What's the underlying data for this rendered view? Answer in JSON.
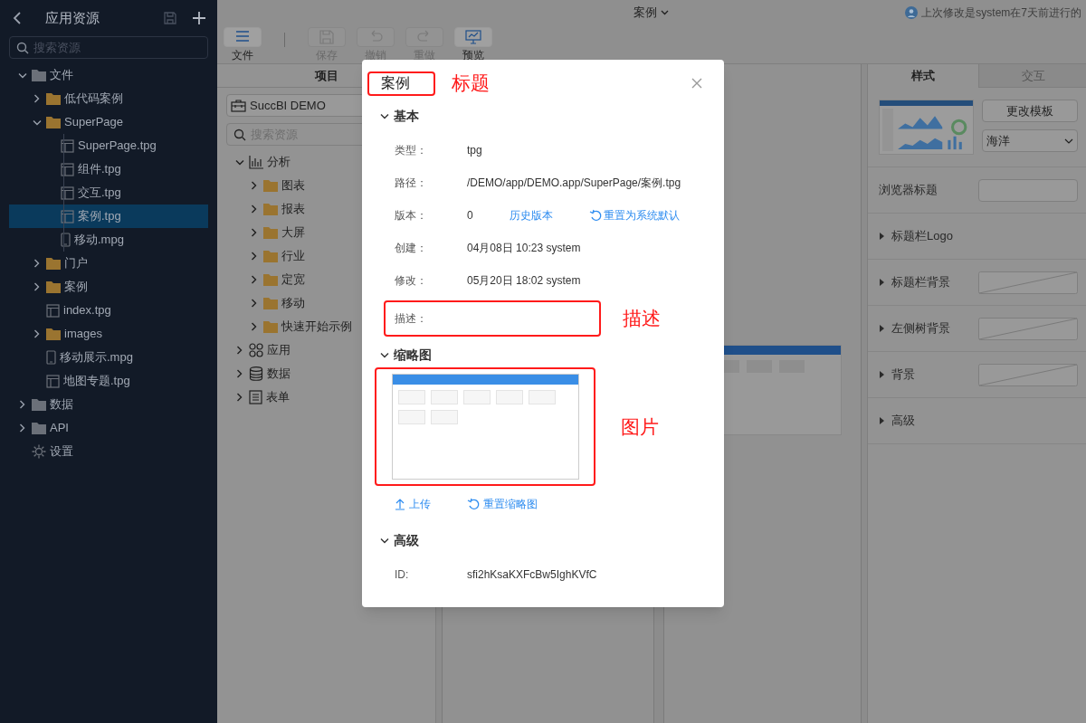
{
  "sidebar": {
    "title": "应用资源",
    "search": {
      "placeholder": "搜索资源"
    },
    "tree": [
      {
        "label": "文件",
        "kind": "folder",
        "expanded": true,
        "selected": false,
        "children": [
          {
            "label": "低代码案例",
            "kind": "folder",
            "expanded": false,
            "selected": false
          },
          {
            "label": "SuperPage",
            "kind": "folder",
            "expanded": true,
            "selected": false,
            "children": [
              {
                "label": "SuperPage.tpg",
                "kind": "page",
                "selected": false
              },
              {
                "label": "组件.tpg",
                "kind": "page",
                "selected": false
              },
              {
                "label": "交互.tpg",
                "kind": "page",
                "selected": false
              },
              {
                "label": "案例.tpg",
                "kind": "page",
                "selected": true
              },
              {
                "label": "移动.mpg",
                "kind": "mobile",
                "selected": false
              }
            ]
          },
          {
            "label": "门户",
            "kind": "folder",
            "expanded": false,
            "selected": false
          },
          {
            "label": "案例",
            "kind": "folder",
            "expanded": false,
            "selected": false
          },
          {
            "label": "index.tpg",
            "kind": "page",
            "selected": false
          },
          {
            "label": "images",
            "kind": "folder",
            "expanded": false,
            "selected": false
          },
          {
            "label": "移动展示.mpg",
            "kind": "mobile",
            "selected": false
          },
          {
            "label": "地图专题.tpg",
            "kind": "page",
            "selected": false
          }
        ]
      },
      {
        "label": "数据",
        "kind": "folder",
        "expanded": false,
        "selected": false
      },
      {
        "label": "API",
        "kind": "folder",
        "expanded": false,
        "selected": false
      },
      {
        "label": "设置",
        "kind": "settings",
        "selected": false
      }
    ]
  },
  "topbar": {
    "title": "案例",
    "last_modified": "上次修改是system在7天前进行的"
  },
  "toolbar": [
    {
      "label": "文件",
      "kind": "menu",
      "disabled": false
    },
    {
      "label": "保存",
      "kind": "save",
      "disabled": true
    },
    {
      "label": "撤销",
      "kind": "undo",
      "disabled": true
    },
    {
      "label": "重做",
      "kind": "redo",
      "disabled": true
    },
    {
      "label": "预览",
      "kind": "preview",
      "disabled": false
    }
  ],
  "project_panel": {
    "header": "项目",
    "project": "SuccBI DEMO",
    "search": {
      "placeholder": "搜索资源"
    },
    "tree": [
      {
        "label": "分析",
        "kind": "chart",
        "expanded": true,
        "selected": false,
        "children": [
          {
            "label": "图表",
            "kind": "folder",
            "expanded": false,
            "selected": false
          },
          {
            "label": "报表",
            "kind": "folder",
            "expanded": false,
            "selected": false
          },
          {
            "label": "大屏",
            "kind": "folder",
            "expanded": false,
            "selected": false
          },
          {
            "label": "行业",
            "kind": "folder",
            "expanded": false,
            "selected": false
          },
          {
            "label": "定宽",
            "kind": "folder",
            "expanded": false,
            "selected": false
          },
          {
            "label": "移动",
            "kind": "folder",
            "expanded": false,
            "selected": false
          },
          {
            "label": "快速开始示例",
            "kind": "folder",
            "expanded": false,
            "selected": false
          }
        ]
      },
      {
        "label": "应用",
        "kind": "apps",
        "expanded": false,
        "selected": false
      },
      {
        "label": "数据",
        "kind": "database",
        "expanded": false,
        "selected": false
      },
      {
        "label": "表单",
        "kind": "form",
        "expanded": false,
        "selected": false
      }
    ]
  },
  "style_panel": {
    "tabs": [
      {
        "label": "样式",
        "selected": true
      },
      {
        "label": "交互",
        "selected": false
      }
    ],
    "change_template": "更改模板",
    "theme": "海洋",
    "rows": [
      {
        "label": "浏览器标题",
        "kind": "input"
      },
      {
        "label": "标题栏Logo",
        "kind": "section",
        "expanded": false,
        "swatch": false
      },
      {
        "label": "标题栏背景",
        "kind": "section",
        "expanded": false,
        "swatch": true
      },
      {
        "label": "左侧树背景",
        "kind": "section",
        "expanded": false,
        "swatch": true
      },
      {
        "label": "背景",
        "kind": "section",
        "expanded": false,
        "swatch": true
      },
      {
        "label": "高级",
        "kind": "section",
        "expanded": false,
        "swatch": false
      }
    ]
  },
  "dialog": {
    "title": "案例",
    "title_annotation": "标题",
    "sections": [
      {
        "title": "基本",
        "kind": "fields",
        "expanded": true,
        "fields": [
          {
            "label": "类型：",
            "value": "tpg"
          },
          {
            "label": "路径：",
            "value": "/DEMO/app/DEMO.app/SuperPage/案例.tpg"
          },
          {
            "label": "版本：",
            "value": "0",
            "links": [
              {
                "label": "历史版本",
                "kind": "plain"
              },
              {
                "label": "重置为系统默认",
                "kind": "reset"
              }
            ]
          },
          {
            "label": "创建：",
            "value": "04月08日 10:23 system"
          },
          {
            "label": "修改：",
            "value": "05月20日 18:02 system"
          },
          {
            "label": "描述：",
            "annotation": "描述"
          }
        ]
      },
      {
        "title": "缩略图",
        "kind": "thumbnail",
        "expanded": true,
        "annotation": "图片",
        "actions": [
          {
            "label": "上传",
            "kind": "upload"
          },
          {
            "label": "重置缩略图",
            "kind": "reset"
          }
        ]
      },
      {
        "title": "高级",
        "kind": "fields",
        "expanded": true,
        "fields": [
          {
            "label": "ID:",
            "value": "sfi2hKsaKXFcBw5IghKVfC"
          }
        ]
      }
    ]
  }
}
